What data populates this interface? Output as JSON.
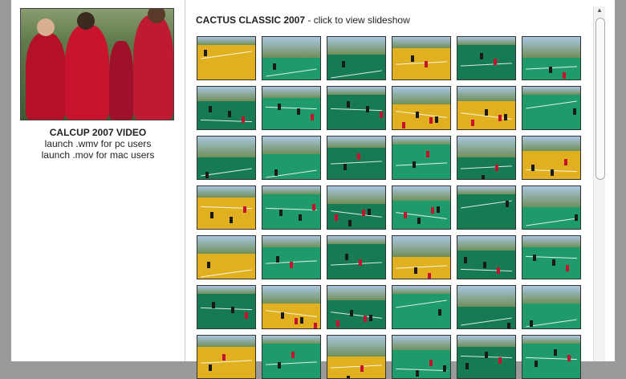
{
  "video": {
    "title": "CALCUP 2007 VIDEO",
    "wmv_link": "launch .wmv for pc users",
    "mov_link": "launch .mov for mac users"
  },
  "gallery": {
    "title": "CACTUS CLASSIC 2007",
    "subtitle": " - click to view slideshow",
    "thumbnail_count": 42
  },
  "colors": {
    "turf": "#1f9a6a",
    "turf_dark": "#167a52",
    "sky": "#a9c6e0",
    "jersey": "#c8102e",
    "gold": "#e0b020"
  },
  "scrollbar": {
    "up_icon": "chevron-up-icon"
  }
}
